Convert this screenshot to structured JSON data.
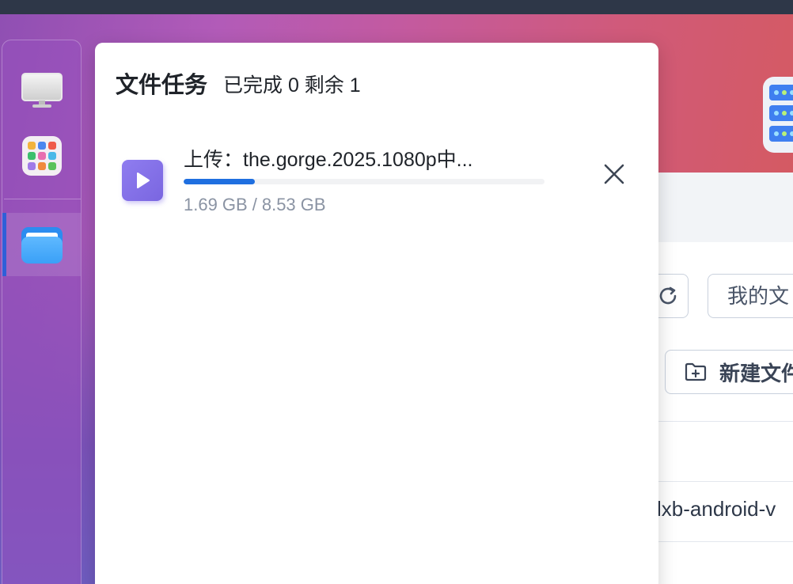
{
  "panel": {
    "title": "文件任务",
    "status": "已完成 0 剩余 1"
  },
  "task": {
    "name": "上传：the.gorge.2025.1080p中...",
    "uploaded": "1.69 GB",
    "separator": "/",
    "total": "8.53 GB",
    "progress_fraction": 0.198,
    "icon": "video-play-icon"
  },
  "background_app": {
    "mydocs_label": "我的文",
    "new_folder_label": "新建文件",
    "file_name": "lxb-android-v"
  },
  "dock": {
    "items": [
      {
        "icon": "desktop-icon"
      },
      {
        "icon": "app-center-icon"
      },
      {
        "icon": "file-manager-icon"
      }
    ]
  },
  "colors": {
    "accent": "#1f6fe0",
    "task_icon": "#8f7df0",
    "dock_active": "#2f5fd8"
  }
}
